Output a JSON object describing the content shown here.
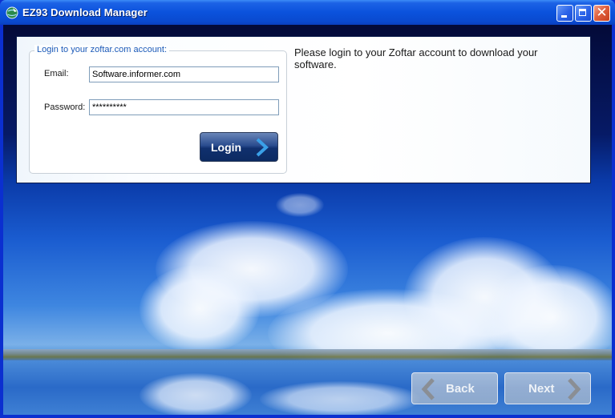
{
  "window": {
    "title": "EZ93 Download Manager",
    "icons": {
      "app": "globe-download-icon",
      "minimize": "minimize-icon",
      "maximize": "maximize-icon",
      "close": "close-icon"
    },
    "close_glyph": "✕"
  },
  "login_form": {
    "group_title": "Login to your zoftar.com account:",
    "email_label": "Email:",
    "email_value": "Software.informer.com",
    "password_label": "Password:",
    "password_value": "**********",
    "login_button": "Login"
  },
  "info_text": "Please login to your Zoftar account to download your software.",
  "navigation": {
    "back_label": "Back",
    "next_label": "Next"
  },
  "colors": {
    "titlebar": "#0b52dc",
    "legend_text": "#1c5ab8",
    "login_button": "#10306e",
    "close_button": "#e0603e"
  }
}
